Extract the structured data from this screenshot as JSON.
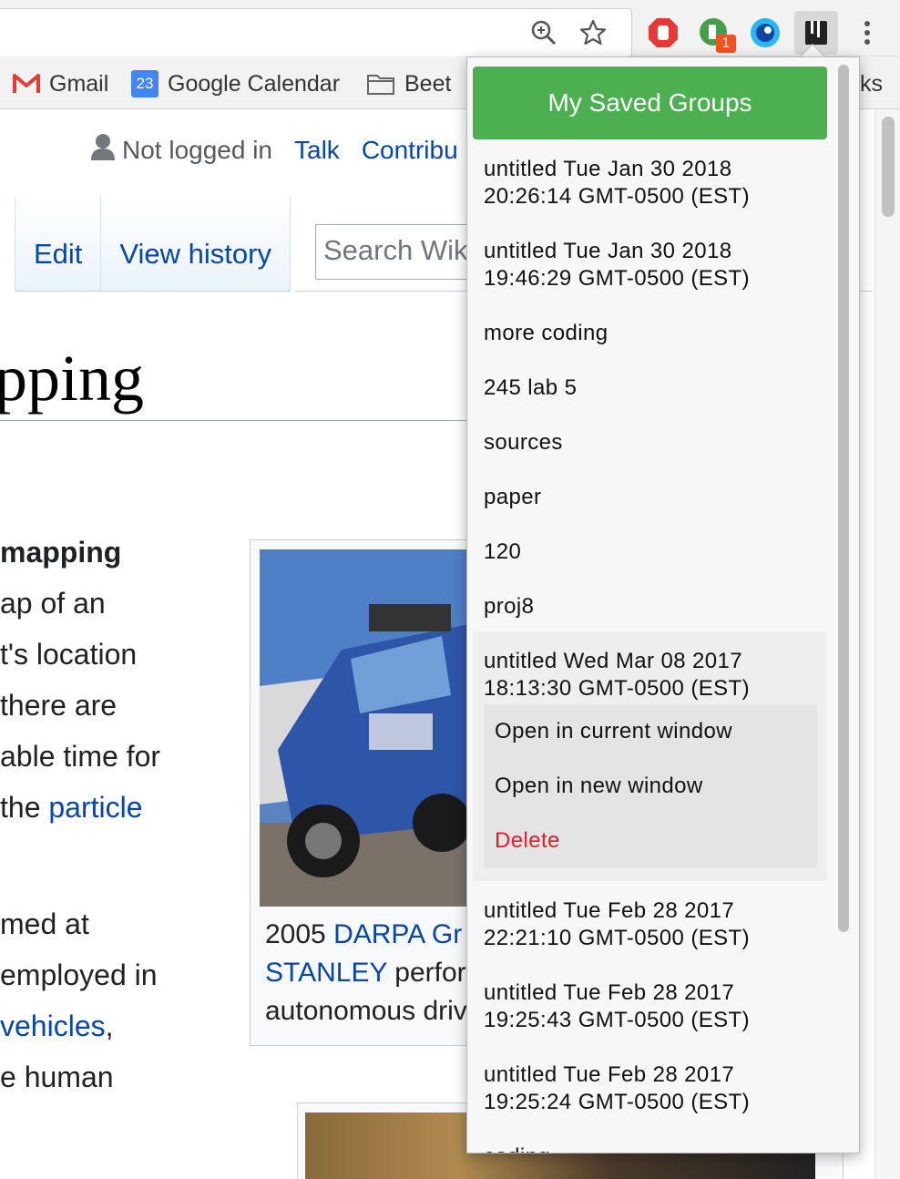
{
  "browser": {
    "toolbar_icons": [
      "zoom-icon",
      "star-icon",
      "adblock-icon",
      "extension-badge-icon",
      "eye-icon",
      "tab-groups-icon",
      "menu-dots-icon"
    ],
    "extension_badge_count": "1",
    "bookmarks": [
      {
        "label": "Gmail",
        "icon": "gmail-icon"
      },
      {
        "label": "Google Calendar",
        "icon": "calendar-icon",
        "icon_text": "23"
      },
      {
        "label": "Beet",
        "icon": "folder-icon"
      }
    ],
    "bookmarks_overflow_text": "ks"
  },
  "wiki": {
    "user_status": "Not logged in",
    "talk_link": "Talk",
    "contrib_link": "Contribu",
    "tabs": [
      "Edit",
      "View history"
    ],
    "search_placeholder": "Search Wiki",
    "title_fragment": "pping",
    "body_lines": [
      {
        "text": "mapping",
        "bold": true
      },
      {
        "text": "ap of an"
      },
      {
        "text": "t's location"
      },
      {
        "text": "there are"
      },
      {
        "text": "able time for"
      },
      {
        "pre": "the ",
        "link": "particle"
      }
    ],
    "body_lines_2": [
      {
        "text": "med at"
      },
      {
        "text": "employed in"
      },
      {
        "link": "vehicles",
        "post": ","
      },
      {
        "text": "e human"
      }
    ],
    "caption": {
      "line1_pre": "2005 ",
      "line1_link": "DARPA Gr",
      "line2_link": "STANLEY",
      "line2_post": " perfor",
      "line3": "autonomous driv"
    }
  },
  "popup": {
    "title": "My Saved Groups",
    "groups": [
      {
        "line1": "untitled Tue Jan 30 2018",
        "line2": "20:26:14 GMT-0500 (EST)"
      },
      {
        "line1": "untitled Tue Jan 30 2018",
        "line2": "19:46:29 GMT-0500 (EST)"
      },
      {
        "line1": "more coding"
      },
      {
        "line1": "245 lab 5"
      },
      {
        "line1": "sources"
      },
      {
        "line1": "paper"
      },
      {
        "line1": "120"
      },
      {
        "line1": "proj8"
      },
      {
        "line1": "untitled Wed Mar 08 2017",
        "line2": "18:13:30 GMT-0500 (EST)",
        "expanded": true
      },
      {
        "line1": "untitled Tue Feb 28 2017",
        "line2": "22:21:10 GMT-0500 (EST)"
      },
      {
        "line1": "untitled Tue Feb 28 2017",
        "line2": "19:25:43 GMT-0500 (EST)"
      },
      {
        "line1": "untitled Tue Feb 28 2017",
        "line2": "19:25:24 GMT-0500 (EST)"
      },
      {
        "line1": "coding"
      }
    ],
    "group_menu": {
      "open_current": "Open in current window",
      "open_new": "Open in new window",
      "delete": "Delete"
    },
    "colors": {
      "header": "#4caf50",
      "delete": "#e8192c"
    }
  }
}
